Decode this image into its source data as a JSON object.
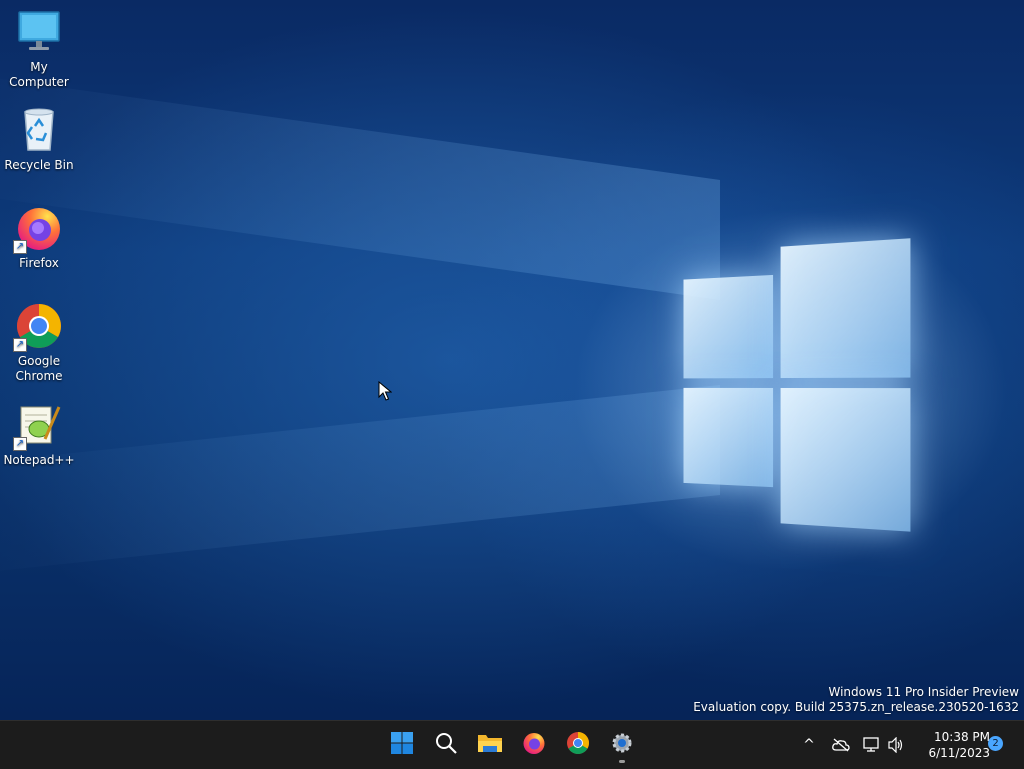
{
  "desktop": {
    "icons": [
      {
        "label": "My Computer",
        "icon": "monitor-icon",
        "shortcut": false
      },
      {
        "label": "Recycle Bin",
        "icon": "recycle-bin-icon",
        "shortcut": false
      },
      {
        "label": "Firefox",
        "icon": "firefox-icon",
        "shortcut": true
      },
      {
        "label": "Google Chrome",
        "icon": "chrome-icon",
        "shortcut": true
      },
      {
        "label": "Notepad++",
        "icon": "notepad-plus-plus-icon",
        "shortcut": true
      }
    ],
    "watermark": {
      "line1": "Windows 11 Pro Insider Preview",
      "line2": "Evaluation copy. Build 25375.zn_release.230520-1632"
    }
  },
  "taskbar": {
    "pinned": [
      {
        "name": "Start",
        "icon": "windows-start-icon"
      },
      {
        "name": "Search",
        "icon": "search-icon"
      },
      {
        "name": "File Explorer",
        "icon": "folder-icon"
      },
      {
        "name": "Firefox",
        "icon": "firefox-icon"
      },
      {
        "name": "Google Chrome",
        "icon": "chrome-icon"
      },
      {
        "name": "Settings",
        "icon": "gear-icon",
        "running": true
      }
    ],
    "tray": {
      "overflow_symbol": "^",
      "time": "10:38 PM",
      "date": "6/11/2023",
      "notification_count": "2"
    }
  },
  "colors": {
    "accent": "#0078d4",
    "taskbar_bg": "#1c1c1c",
    "badge": "#4aa6ff"
  }
}
